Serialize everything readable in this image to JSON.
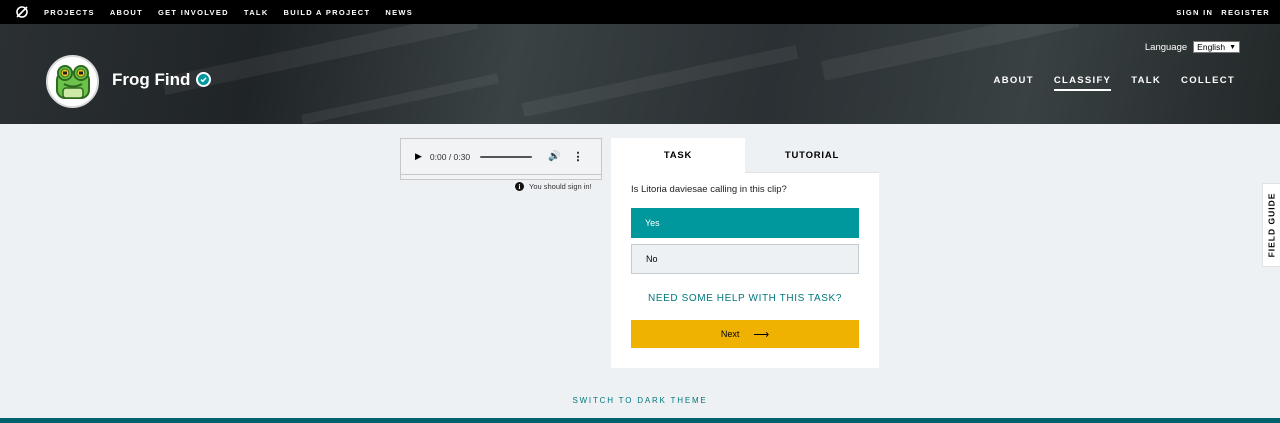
{
  "topnav": {
    "items": [
      "PROJECTS",
      "ABOUT",
      "GET INVOLVED",
      "TALK",
      "BUILD A PROJECT",
      "NEWS"
    ],
    "sign_in": "SIGN IN",
    "register": "REGISTER"
  },
  "project": {
    "name": "Frog Find",
    "language_label": "Language",
    "language_value": "English",
    "nav": [
      "ABOUT",
      "CLASSIFY",
      "TALK",
      "COLLECT"
    ],
    "active_nav": "CLASSIFY"
  },
  "audio": {
    "time": "0:00 / 0:30",
    "notice": "You should sign in!"
  },
  "task": {
    "tabs": [
      "TASK",
      "TUTORIAL"
    ],
    "question": "Is Litoria daviesae calling in this clip?",
    "answers": [
      "Yes",
      "No"
    ],
    "selected": "Yes",
    "help": "NEED SOME HELP WITH THIS TASK?",
    "next": "Next"
  },
  "field_guide": "FIELD GUIDE",
  "theme_toggle": "SWITCH TO DARK THEME",
  "colors": {
    "teal": "#00979d",
    "teal_text": "#00787d",
    "next_yellow": "#f0b200",
    "background": "#eef1f4"
  }
}
